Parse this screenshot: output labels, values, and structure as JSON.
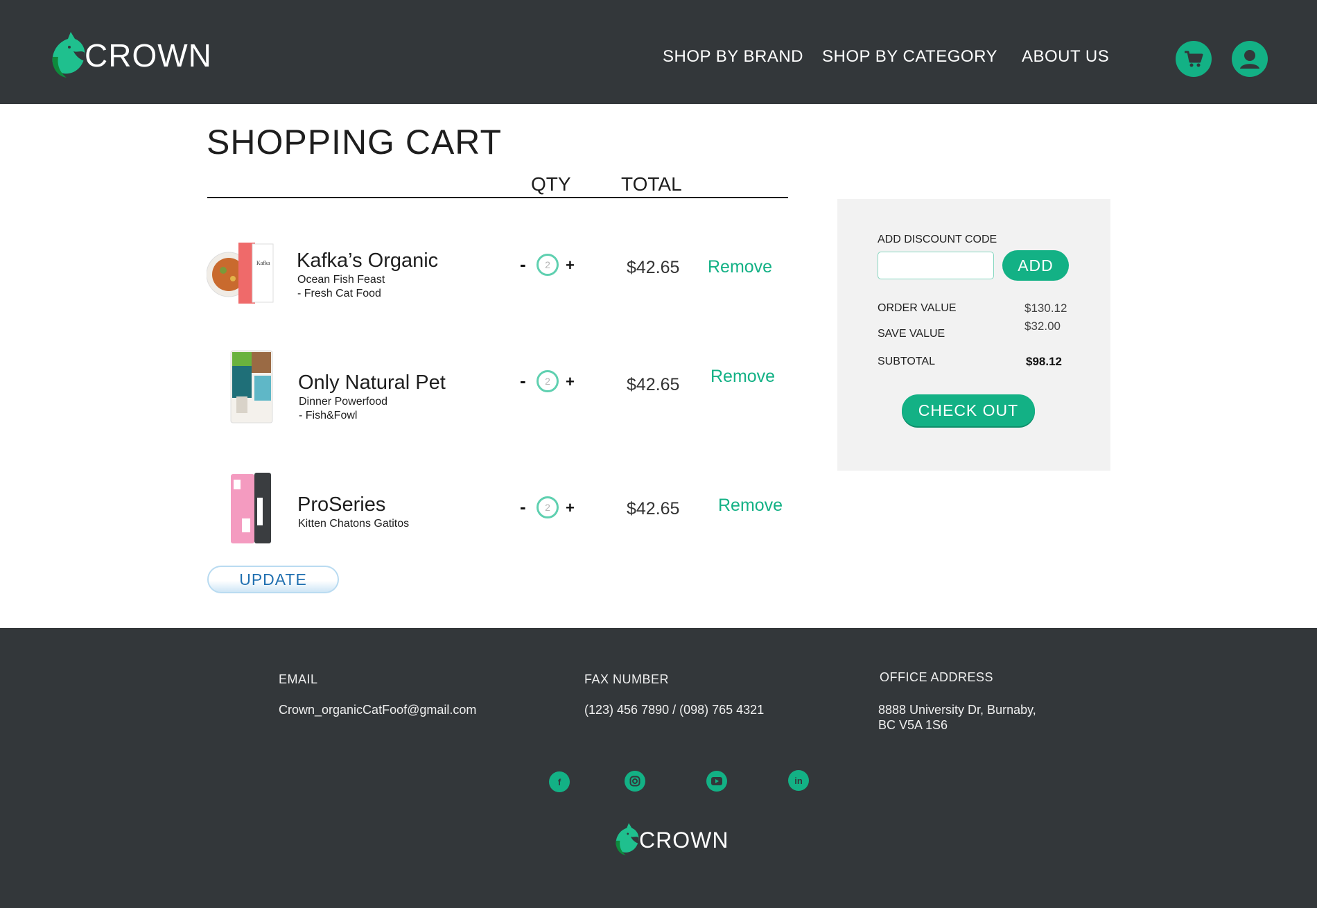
{
  "brand": {
    "name": "CROWN",
    "accent": "#13b185",
    "dark": "#33373a"
  },
  "nav": {
    "items": [
      "SHOP BY BRAND",
      "SHOP BY CATEGORY",
      "ABOUT US"
    ],
    "cart_icon": "cart-icon",
    "account_icon": "user-icon"
  },
  "cart": {
    "title": "SHOPPING CART",
    "col_qty": "QTY",
    "col_total": "TOTAL",
    "remove_label": "Remove",
    "update_label": "UPDATE",
    "items": [
      {
        "name": "Kafka’s Organic",
        "sub1": "Ocean Fish Feast",
        "sub2": "- Fresh Cat Food",
        "qty": "2",
        "total": "$42.65"
      },
      {
        "name": "Only Natural Pet",
        "sub1": "Dinner Powerfood",
        "sub2": "- Fish&Fowl",
        "qty": "2",
        "total": "$42.65"
      },
      {
        "name": "ProSeries",
        "sub1": "Kitten Chatons Gatitos",
        "sub2": "",
        "qty": "2",
        "total": "$42.65"
      }
    ],
    "minus": "-",
    "plus": "+"
  },
  "summary": {
    "discount_label": "ADD DISCOUNT CODE",
    "discount_value": "",
    "add_label": "ADD",
    "order_label": "ORDER VALUE",
    "order_value": "$130.12",
    "save_label": "SAVE VALUE",
    "save_value": "$32.00",
    "subtotal_label": "SUBTOTAL",
    "subtotal_value": "$98.12",
    "checkout_label": "CHECK OUT"
  },
  "footer": {
    "email_label": "EMAIL",
    "email_value": "Crown_organicCatFoof@gmail.com",
    "fax_label": "FAX NUMBER",
    "fax_value": "(123) 456 7890 / (098) 765 4321",
    "office_label": "OFFICE ADDRESS",
    "office_line1": "8888 University Dr, Burnaby,",
    "office_line2": "BC V5A 1S6",
    "social": [
      "facebook-icon",
      "instagram-icon",
      "youtube-icon",
      "linkedin-icon"
    ]
  }
}
